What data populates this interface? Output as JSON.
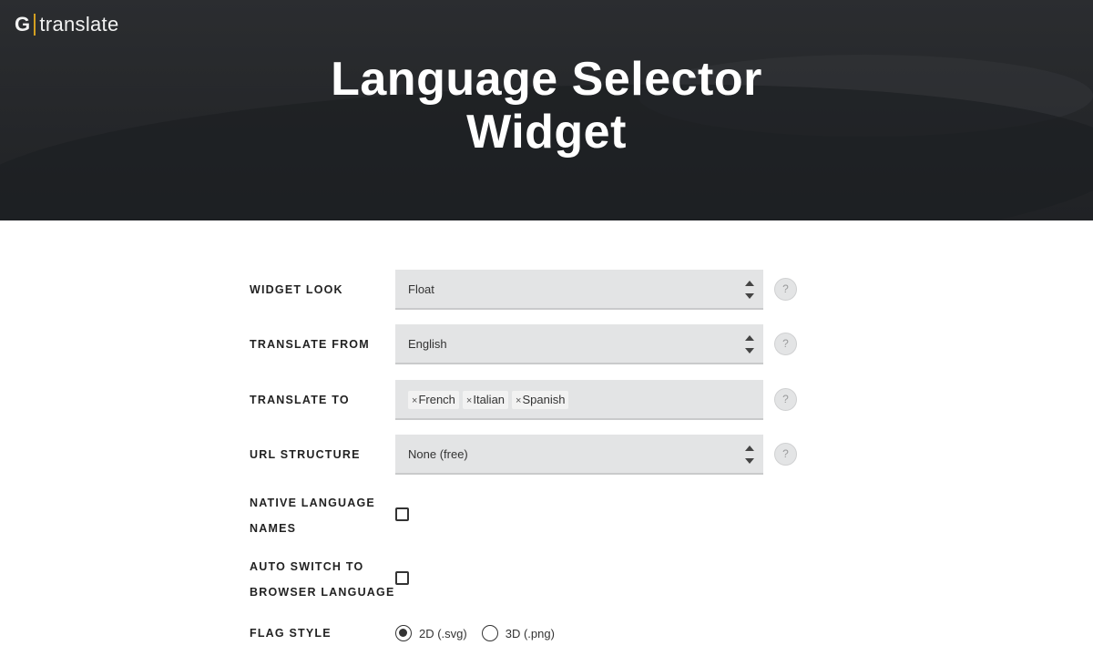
{
  "header": {
    "logo_letter": "G",
    "logo_word": "translate",
    "title_line1": "Language Selector",
    "title_line2": "Widget"
  },
  "form": {
    "widget_look": {
      "label": "WIDGET LOOK",
      "value": "Float",
      "help": "?"
    },
    "translate_from": {
      "label": "TRANSLATE FROM",
      "value": "English",
      "help": "?"
    },
    "translate_to": {
      "label": "TRANSLATE TO",
      "tags": [
        "French",
        "Italian",
        "Spanish"
      ],
      "remove_glyph": "×",
      "help": "?"
    },
    "url_structure": {
      "label": "URL STRUCTURE",
      "value": "None (free)",
      "help": "?"
    },
    "native_language_names": {
      "label_line1": "NATIVE LANGUAGE",
      "label_line2": "NAMES",
      "checked": false
    },
    "auto_switch": {
      "label_line1": "AUTO SWITCH TO",
      "label_line2": "BROWSER LANGUAGE",
      "checked": false
    },
    "flag_style": {
      "label": "FLAG STYLE",
      "options": [
        {
          "label": "2D (.svg)",
          "checked": true
        },
        {
          "label": "3D (.png)",
          "checked": false
        }
      ]
    }
  },
  "colors": {
    "hero_bg": "#26282b",
    "logo_accent": "#d4a021",
    "field_bg": "#e3e4e5"
  },
  "icons": [
    "select-arrows-icon",
    "help-icon",
    "tag-remove-icon"
  ]
}
